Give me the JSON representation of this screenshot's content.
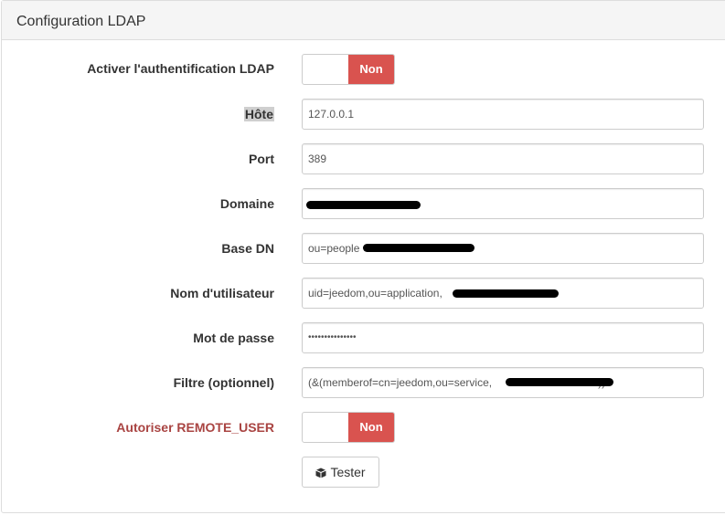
{
  "panel": {
    "title": "Configuration LDAP"
  },
  "fields": {
    "enable_ldap": {
      "label": "Activer l'authentification LDAP",
      "state": "Non"
    },
    "host": {
      "label": "Hôte",
      "value": "127.0.0.1"
    },
    "port": {
      "label": "Port",
      "value": "389"
    },
    "domain": {
      "label": "Domaine",
      "value": ""
    },
    "base_dn": {
      "label": "Base DN",
      "value": "ou=people"
    },
    "username": {
      "label": "Nom d'utilisateur",
      "value": "uid=jeedom,ou=application,"
    },
    "password": {
      "label": "Mot de passe",
      "value": "•••••••••••••••"
    },
    "filter": {
      "label": "Filtre (optionnel)",
      "value": "(&(memberof=cn=jeedom,ou=service,",
      "suffix": "))"
    },
    "remote_user": {
      "label": "Autoriser REMOTE_USER",
      "state": "Non"
    }
  },
  "test_button": {
    "label": "Tester",
    "icon": "cube-icon"
  },
  "colors": {
    "danger": "#d9534f",
    "danger_text": "#a94442",
    "heading_bg": "#f5f5f5"
  }
}
